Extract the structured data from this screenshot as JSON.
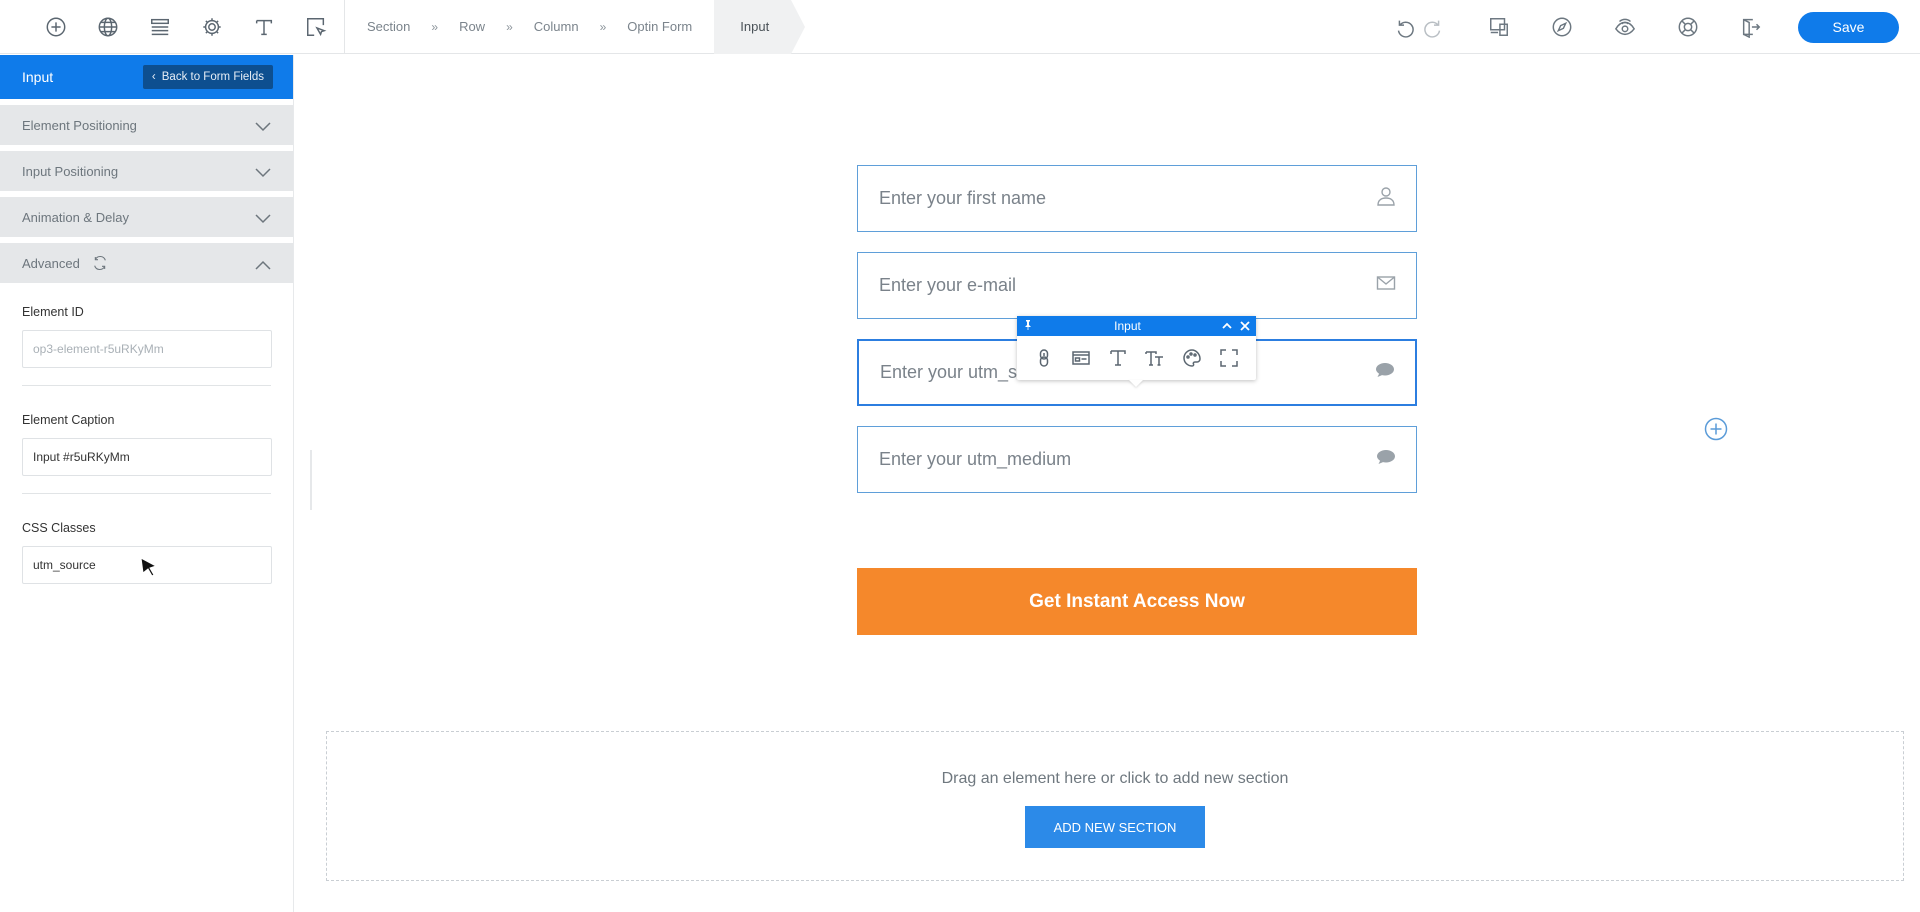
{
  "toolbar": {
    "icons": [
      "add-element-icon",
      "globe-icon",
      "sections-icon",
      "settings-icon",
      "typography-icon",
      "selector-icon"
    ],
    "breadcrumb": [
      "Section",
      "Row",
      "Column",
      "Optin Form"
    ],
    "breadcrumb_separator": "»",
    "breadcrumb_active": "Input",
    "save_label": "Save",
    "right_icons": [
      "undo-icon",
      "redo-icon",
      "devices-icon",
      "compass-icon",
      "preview-icon",
      "help-icon",
      "exit-icon"
    ]
  },
  "sidebar": {
    "title": "Input",
    "back_label": "Back to Form Fields",
    "sections": [
      {
        "label": "Element Positioning",
        "expanded": false
      },
      {
        "label": "Input Positioning",
        "expanded": false
      },
      {
        "label": "Animation & Delay",
        "expanded": false
      },
      {
        "label": "Advanced",
        "expanded": true
      }
    ],
    "element_id": {
      "label": "Element ID",
      "placeholder": "op3-element-r5uRKyMm"
    },
    "element_caption": {
      "label": "Element Caption",
      "value": "Input #r5uRKyMm"
    },
    "css_classes": {
      "label": "CSS Classes",
      "value": "utm_source"
    }
  },
  "canvas": {
    "fields": [
      {
        "placeholder": "Enter your first name",
        "icon": "user-icon"
      },
      {
        "placeholder": "Enter your e-mail",
        "icon": "envelope-icon"
      },
      {
        "placeholder": "Enter your utm_source",
        "icon": "comment-icon",
        "selected": true
      },
      {
        "placeholder": "Enter your utm_medium",
        "icon": "comment-icon"
      }
    ],
    "cta_label": "Get Instant Access Now",
    "floating_toolbar": {
      "title": "Input"
    },
    "drop_text": "Drag an element here or click to add new section",
    "add_section_label": "ADD NEW SECTION"
  },
  "colors": {
    "accent": "#0f7bea",
    "cta": "#f5882b",
    "field_border": "#5f9fd9"
  }
}
